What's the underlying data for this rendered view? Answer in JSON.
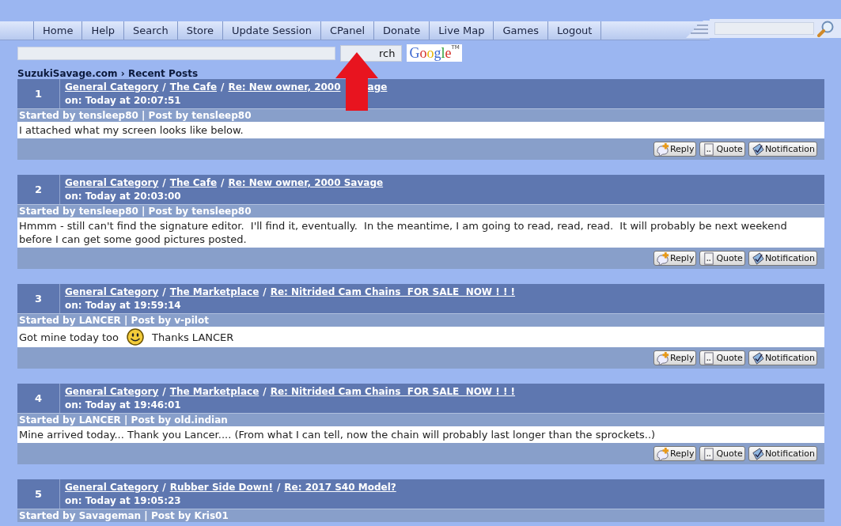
{
  "nav": {
    "items": [
      {
        "label": "Home"
      },
      {
        "label": "Help"
      },
      {
        "label": "Search"
      },
      {
        "label": "Store"
      },
      {
        "label": "Update Session"
      },
      {
        "label": "CPanel"
      },
      {
        "label": "Donate"
      },
      {
        "label": "Live Map"
      },
      {
        "label": "Games"
      },
      {
        "label": "Logout"
      }
    ]
  },
  "google_search": {
    "button": "rch",
    "logo": "Google",
    "logo_mark": "TM"
  },
  "breadcrumb": {
    "site": "SuzukiSavage.com",
    "separator": "›",
    "page": "Recent Posts"
  },
  "posts": [
    {
      "number": "1",
      "category": "General Category",
      "separator": "/",
      "board": "The Cafe",
      "topic": "Re: New owner, 2000",
      "topic_tail": "age",
      "time": "on: Today at 20:07:51",
      "byline": "Started by tensleep80 | Post by tensleep80",
      "body": [
        {
          "kind": "text",
          "text": "I attached what my screen looks like below."
        }
      ],
      "actions": [
        "Reply",
        "Quote",
        "Notification"
      ]
    },
    {
      "number": "2",
      "category": "General Category",
      "separator": "/",
      "board": "The Cafe",
      "topic": "Re: New owner, 2000 Savage",
      "time": "on: Today at 20:03:00",
      "byline": "Started by tensleep80 | Post by tensleep80",
      "body": [
        {
          "kind": "text",
          "text": "Hmmm - still can't find the signature editor.  I'll find it, eventually.  In the meantime, I am going to read, read, read.  It will probably be next weekend before I can get some good pictures posted."
        }
      ],
      "actions": [
        "Reply",
        "Quote",
        "Notification"
      ]
    },
    {
      "number": "3",
      "category": "General Category",
      "separator": "/",
      "board": "The Marketplace",
      "topic": "Re: Nitrided Cam Chains  FOR SALE  NOW ! ! !",
      "time": "on: Today at 19:59:14",
      "byline": "Started by LANCER | Post by v-pilot",
      "body": [
        {
          "kind": "text",
          "text": "Got mine today too"
        },
        {
          "kind": "smiley"
        },
        {
          "kind": "text",
          "text": "Thanks LANCER"
        }
      ],
      "actions": [
        "Reply",
        "Quote",
        "Notification"
      ]
    },
    {
      "number": "4",
      "category": "General Category",
      "separator": "/",
      "board": "The Marketplace",
      "topic": "Re: Nitrided Cam Chains  FOR SALE  NOW ! ! !",
      "time": "on: Today at 19:46:01",
      "byline": "Started by LANCER | Post by old.indian",
      "body": [
        {
          "kind": "text",
          "text": "Mine arrived today... Thank you Lancer.... (From what I can tell, now the chain will probably last longer than the sprockets..)"
        }
      ],
      "actions": [
        "Reply",
        "Quote",
        "Notification"
      ]
    },
    {
      "number": "5",
      "category": "General Category",
      "separator": "/",
      "board": "Rubber Side Down!",
      "topic": "Re: 2017 S40 Model?",
      "time": "on: Today at 19:05:23",
      "byline": "Started by Savageman | Post by Kris01"
    }
  ]
}
